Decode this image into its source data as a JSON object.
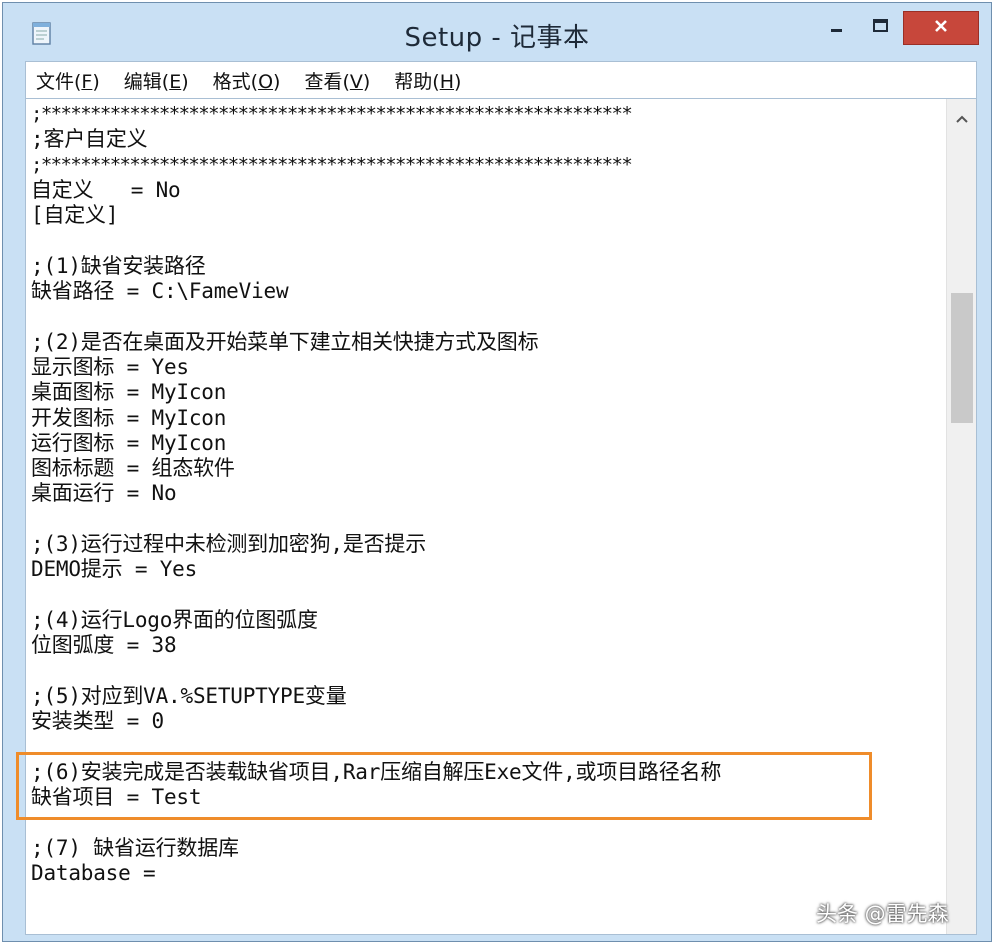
{
  "window": {
    "title": "Setup - 记事本",
    "icon": "notepad-icon",
    "controls": {
      "minimize": "minimize-icon",
      "maximize": "maximize-icon",
      "close": "close-icon"
    }
  },
  "menu": [
    {
      "name": "menu-file",
      "label": "文件(",
      "acc": "F",
      "tail": ")"
    },
    {
      "name": "menu-edit",
      "label": "编辑(",
      "acc": "E",
      "tail": ")"
    },
    {
      "name": "menu-format",
      "label": "格式(",
      "acc": "O",
      "tail": ")"
    },
    {
      "name": "menu-view",
      "label": "查看(",
      "acc": "V",
      "tail": ")"
    },
    {
      "name": "menu-help",
      "label": "帮助(",
      "acc": "H",
      "tail": ")"
    }
  ],
  "document": {
    "lines": [
      ";************************************************************",
      ";客户自定义",
      ";************************************************************",
      "自定义   = No",
      "[自定义]",
      "",
      ";(1)缺省安装路径",
      "缺省路径 = C:\\FameView",
      "",
      ";(2)是否在桌面及开始菜单下建立相关快捷方式及图标",
      "显示图标 = Yes",
      "桌面图标 = MyIcon",
      "开发图标 = MyIcon",
      "运行图标 = MyIcon",
      "图标标题 = 组态软件",
      "桌面运行 = No",
      "",
      ";(3)运行过程中未检测到加密狗,是否提示",
      "DEMO提示 = Yes",
      "",
      ";(4)运行Logo界面的位图弧度",
      "位图弧度 = 38",
      "",
      ";(5)对应到VA.%SETUPTYPE变量",
      "安装类型 = 0",
      "",
      ";(6)安装完成是否装载缺省项目,Rar压缩自解压Exe文件,或项目路径名称",
      "缺省项目 = Test",
      "",
      ";(7) 缺省运行数据库",
      "Database ="
    ]
  },
  "highlight_color": "#ef8c2a",
  "watermark": "头条 @雷先森"
}
